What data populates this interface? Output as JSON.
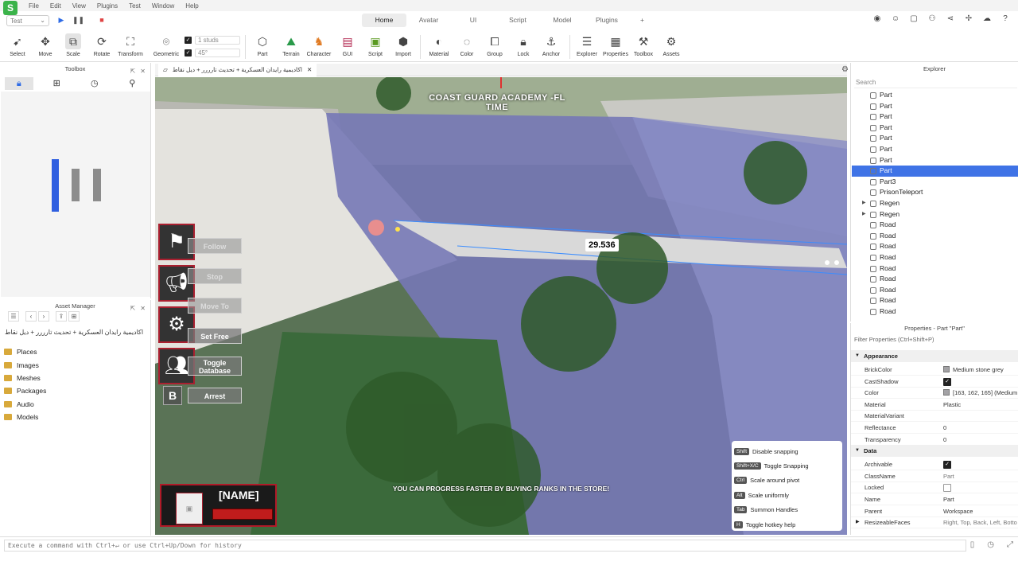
{
  "menu": {
    "logo": "S",
    "items": [
      "File",
      "Edit",
      "View",
      "Plugins",
      "Test",
      "Window",
      "Help"
    ]
  },
  "ribbon": {
    "test_select": "Test",
    "tabs": [
      "Home",
      "Avatar",
      "UI",
      "Script",
      "Model",
      "Plugins",
      "+"
    ],
    "active_tab": "Home",
    "tools": {
      "select": "Select",
      "move": "Move",
      "scale": "Scale",
      "rotate": "Rotate",
      "transform": "Transform",
      "geometric": "Geometric",
      "part": "Part",
      "terrain": "Terrain",
      "character": "Character",
      "gui": "GUI",
      "script": "Script",
      "import": "Import",
      "material": "Material",
      "color": "Color",
      "group": "Group",
      "lock": "Lock",
      "anchor": "Anchor",
      "explorer": "Explorer",
      "properties": "Properties",
      "toolbox": "Toolbox",
      "assets": "Assets"
    },
    "snap": {
      "studs": "1 studs",
      "angle": "45°"
    }
  },
  "toolbox": {
    "title": "Toolbox",
    "tabs": [
      "inventory-icon",
      "grid-icon",
      "recent-icon",
      "marketplace-icon"
    ]
  },
  "asset_manager": {
    "title": "Asset Manager",
    "path": "اكاديمية رايدان العسكرية + تحديث تارررر + ديل نقاط",
    "folders": [
      "Places",
      "Images",
      "Meshes",
      "Packages",
      "Audio",
      "Models"
    ]
  },
  "document_tab": {
    "title": "اكاديمية رايدان العسكرية + تحديث تارررر + ديل نقاط"
  },
  "viewport": {
    "header": "COAST GUARD ACADEMY -FL\nTIME",
    "measurement": "29.536",
    "buttons": [
      "Follow",
      "Stop",
      "Move To",
      "Set Free",
      "Toggle Database",
      "Arrest"
    ],
    "bkey": "B",
    "name_card": "[NAME]",
    "banner": "YOU CAN PROGRESS FASTER BY BUYING RANKS IN THE STORE!",
    "hotkeys": [
      {
        "key": "Shift",
        "label": "Disable snapping"
      },
      {
        "key": "Shift+X/C",
        "label": "Toggle Snapping"
      },
      {
        "key": "Ctrl",
        "label": "Scale around pivot"
      },
      {
        "key": "Alt",
        "label": "Scale uniformly"
      },
      {
        "key": "Tab",
        "label": "Summon Handles"
      },
      {
        "key": "H",
        "label": "Toggle hotkey help"
      }
    ]
  },
  "explorer": {
    "title": "Explorer",
    "search_placeholder": "Search",
    "items": [
      {
        "name": "Part",
        "expandable": false
      },
      {
        "name": "Part",
        "expandable": false
      },
      {
        "name": "Part",
        "expandable": false
      },
      {
        "name": "Part",
        "expandable": false
      },
      {
        "name": "Part",
        "expandable": false
      },
      {
        "name": "Part",
        "expandable": false
      },
      {
        "name": "Part",
        "expandable": false
      },
      {
        "name": "Part",
        "expandable": false,
        "selected": true
      },
      {
        "name": "Part3",
        "expandable": false
      },
      {
        "name": "PrisonTeleport",
        "expandable": false
      },
      {
        "name": "Regen",
        "expandable": true
      },
      {
        "name": "Regen",
        "expandable": true
      },
      {
        "name": "Road",
        "expandable": false
      },
      {
        "name": "Road",
        "expandable": false
      },
      {
        "name": "Road",
        "expandable": false
      },
      {
        "name": "Road",
        "expandable": false
      },
      {
        "name": "Road",
        "expandable": false
      },
      {
        "name": "Road",
        "expandable": false
      },
      {
        "name": "Road",
        "expandable": false
      },
      {
        "name": "Road",
        "expandable": false
      },
      {
        "name": "Road",
        "expandable": false
      }
    ]
  },
  "properties": {
    "title": "Properties - Part \"Part\"",
    "filter_placeholder": "Filter Properties (Ctrl+Shift+P)",
    "sections": [
      {
        "name": "Appearance",
        "rows": [
          {
            "name": "BrickColor",
            "value": "Medium stone grey",
            "swatch": "#a3a2a5"
          },
          {
            "name": "CastShadow",
            "checkbox": true
          },
          {
            "name": "Color",
            "value": "[163, 162, 165] (Medium",
            "swatch": "#a3a2a5"
          },
          {
            "name": "Material",
            "value": "Plastic"
          },
          {
            "name": "MaterialVariant",
            "value": ""
          },
          {
            "name": "Reflectance",
            "value": "0"
          },
          {
            "name": "Transparency",
            "value": "0"
          }
        ]
      },
      {
        "name": "Data",
        "rows": [
          {
            "name": "Archivable",
            "checkbox": true
          },
          {
            "name": "ClassName",
            "value": "Part",
            "gray": true
          },
          {
            "name": "Locked",
            "checkbox": false
          },
          {
            "name": "Name",
            "value": "Part"
          },
          {
            "name": "Parent",
            "value": "Workspace"
          },
          {
            "name": "ResizeableFaces",
            "value": "Right, Top, Back, Left, Botto",
            "gray": true,
            "expandable": true
          }
        ]
      }
    ]
  },
  "command_bar": {
    "placeholder": "Execute a command with Ctrl+↵ or use Ctrl+Up/Down for history"
  },
  "colors": {
    "accent": "#3f73e6",
    "selection": "#3f73e6",
    "ui_red": "#b01a28"
  }
}
